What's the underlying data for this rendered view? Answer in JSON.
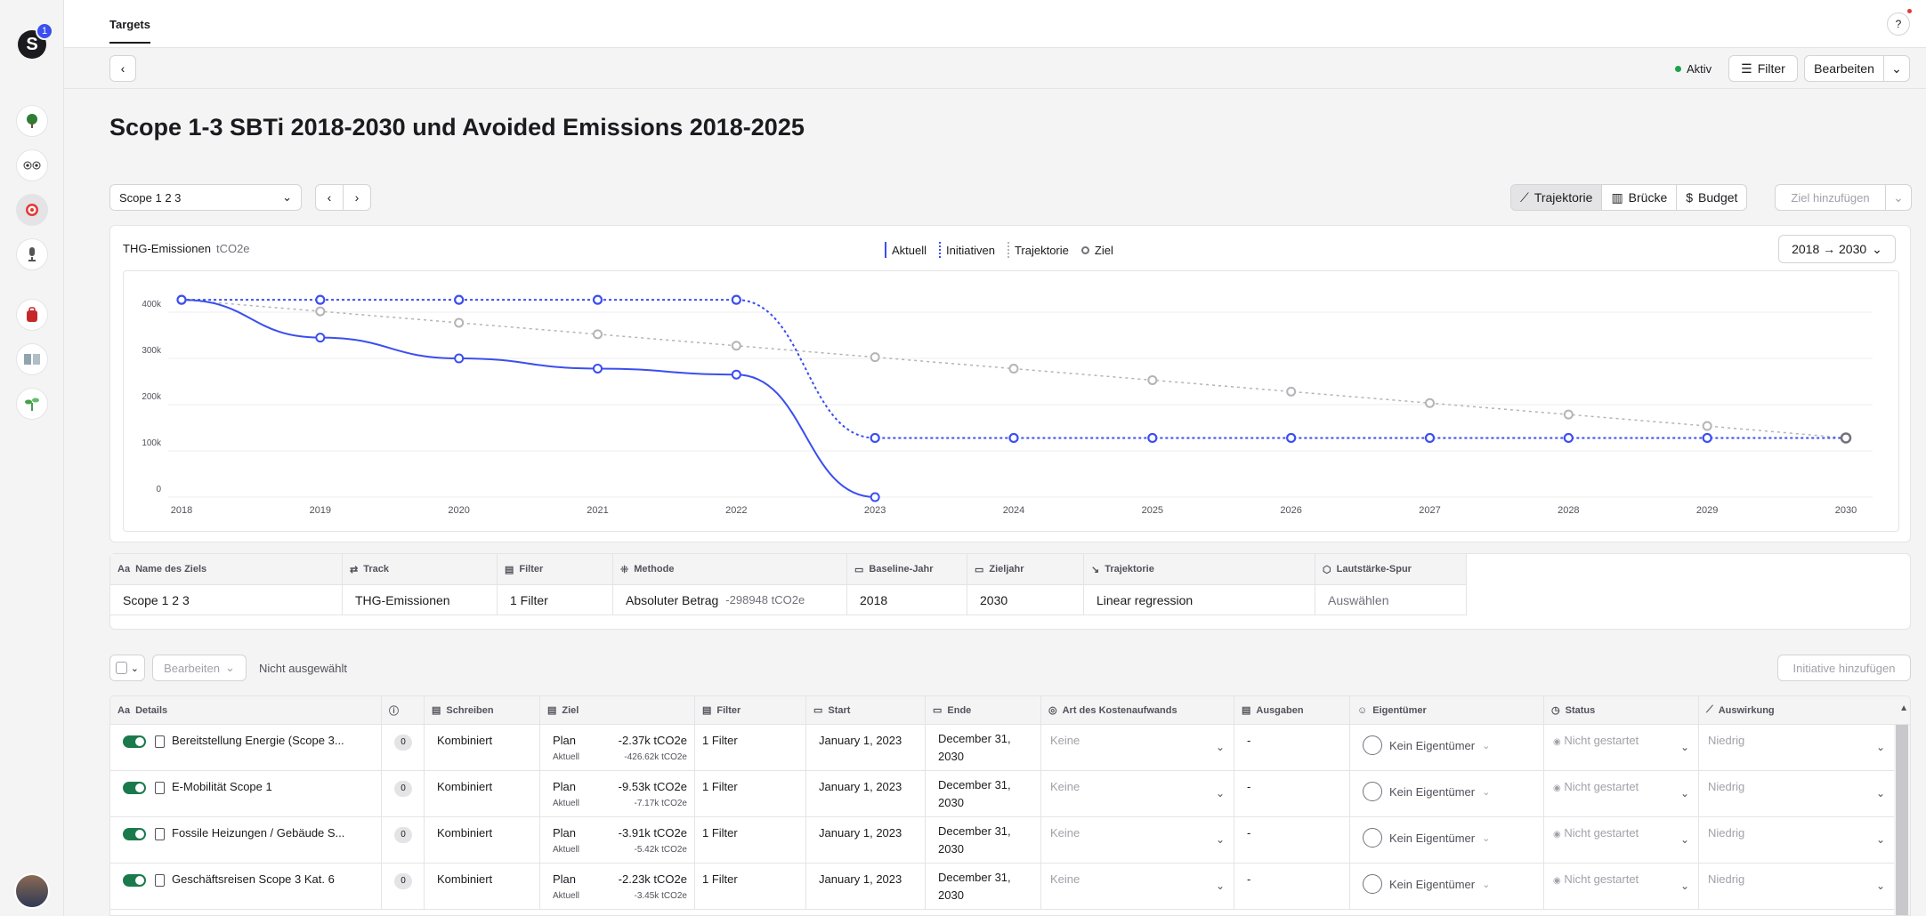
{
  "rail": {
    "notif_count": "1",
    "logo": "S",
    "items": [
      "tree-icon",
      "eyes-icon",
      "target-icon",
      "microphone-icon",
      "backpack-icon",
      "book-icon",
      "seedling-icon"
    ]
  },
  "topbar": {
    "tab": "Targets",
    "help": "?"
  },
  "toolbar": {
    "status": "Aktiv",
    "filter": "Filter",
    "edit": "Bearbeiten"
  },
  "page_title": "Scope 1-3 SBTi 2018-2030 und Avoided Emissions 2018-2025",
  "controls": {
    "scope_select": "Scope 1 2 3",
    "views": [
      "Trajektorie",
      "Brücke",
      "Budget"
    ],
    "add_goal": "Ziel hinzufügen"
  },
  "chart_card": {
    "title": "THG-Emissionen",
    "unit": "tCO2e",
    "legend": {
      "aktuell": "Aktuell",
      "initiativen": "Initiativen",
      "trajektorie": "Trajektorie",
      "ziel": "Ziel"
    },
    "range": "2018 → 2030"
  },
  "chart_data": {
    "type": "line",
    "x": [
      2018,
      2019,
      2020,
      2021,
      2022,
      2023,
      2024,
      2025,
      2026,
      2027,
      2028,
      2029,
      2030
    ],
    "yticks": [
      "0",
      "100k",
      "200k",
      "300k",
      "400k"
    ],
    "ylim": [
      0,
      450000
    ],
    "colors": {
      "aktuell": "#3b4ef0",
      "initiativen": "#3b4ef0",
      "trajektorie": "#b4b4b8",
      "ziel": "#71717a"
    },
    "series": [
      {
        "name": "Aktuell",
        "x": [
          2018,
          2019,
          2020,
          2021,
          2022,
          2023
        ],
        "values": [
          426620,
          345000,
          300000,
          278000,
          265000,
          0
        ]
      },
      {
        "name": "Initiativen",
        "x": [
          2018,
          2019,
          2020,
          2021,
          2022,
          2023,
          2024,
          2025,
          2026,
          2027,
          2028,
          2029,
          2030
        ],
        "values": [
          426620,
          426620,
          426620,
          426620,
          426620,
          128000,
          128000,
          128000,
          128000,
          128000,
          128000,
          128000,
          128000
        ]
      },
      {
        "name": "Trajektorie",
        "x": [
          2018,
          2019,
          2020,
          2021,
          2022,
          2023,
          2024,
          2025,
          2026,
          2027,
          2028,
          2029,
          2030
        ],
        "values": [
          426620,
          401800,
          377000,
          352200,
          327400,
          302600,
          277800,
          253000,
          228200,
          203400,
          178600,
          153800,
          128000
        ]
      },
      {
        "name": "Ziel",
        "x": [
          2030
        ],
        "values": [
          128000
        ]
      }
    ]
  },
  "params": {
    "headers": [
      "Name des Ziels",
      "Track",
      "Filter",
      "Methode",
      "Baseline-Jahr",
      "Zieljahr",
      "Trajektorie",
      "Lautstärke-Spur"
    ],
    "values": {
      "name": "Scope 1 2 3",
      "track": "THG-Emissionen",
      "filter": "1 Filter",
      "method": "Absoluter Betrag",
      "method_sub": "-298948 tCO2e",
      "baseline": "2018",
      "target_year": "2030",
      "trajectory": "Linear regression",
      "spur": "Auswählen"
    }
  },
  "initiatives_bar": {
    "bulk_edit": "Bearbeiten",
    "selection": "Nicht ausgewählt",
    "add": "Initiative hinzufügen"
  },
  "initiatives": {
    "headers": [
      "Details",
      "",
      "Schreiben",
      "Ziel",
      "Filter",
      "Start",
      "Ende",
      "Art des Kostenaufwands",
      "Ausgaben",
      "Eigentümer",
      "Status",
      "Auswirkung"
    ],
    "rows": [
      {
        "name": "Bereitstellung Energie (Scope 3...",
        "count": "0",
        "write": "Kombiniert",
        "plan": "Plan",
        "plan_val": "-2.37k tCO2e",
        "actual": "Aktuell",
        "actual_val": "-426.62k tCO2e",
        "filter": "1 Filter",
        "start": "January 1, 2023",
        "end1": "December 31,",
        "end2": "2030",
        "cost": "Keine",
        "spend": "-",
        "owner": "Kein Eigentümer",
        "status": "Nicht gestartet",
        "impact": "Niedrig"
      },
      {
        "name": "E-Mobilität Scope 1",
        "count": "0",
        "write": "Kombiniert",
        "plan": "Plan",
        "plan_val": "-9.53k tCO2e",
        "actual": "Aktuell",
        "actual_val": "-7.17k tCO2e",
        "filter": "1 Filter",
        "start": "January 1, 2023",
        "end1": "December 31,",
        "end2": "2030",
        "cost": "Keine",
        "spend": "-",
        "owner": "Kein Eigentümer",
        "status": "Nicht gestartet",
        "impact": "Niedrig"
      },
      {
        "name": "Fossile Heizungen / Gebäude S...",
        "count": "0",
        "write": "Kombiniert",
        "plan": "Plan",
        "plan_val": "-3.91k tCO2e",
        "actual": "Aktuell",
        "actual_val": "-5.42k tCO2e",
        "filter": "1 Filter",
        "start": "January 1, 2023",
        "end1": "December 31,",
        "end2": "2030",
        "cost": "Keine",
        "spend": "-",
        "owner": "Kein Eigentümer",
        "status": "Nicht gestartet",
        "impact": "Niedrig"
      },
      {
        "name": "Geschäftsreisen Scope 3 Kat. 6",
        "count": "0",
        "write": "Kombiniert",
        "plan": "Plan",
        "plan_val": "-2.23k tCO2e",
        "actual": "Aktuell",
        "actual_val": "-3.45k tCO2e",
        "filter": "1 Filter",
        "start": "January 1, 2023",
        "end1": "December 31,",
        "end2": "2030",
        "cost": "Keine",
        "spend": "-",
        "owner": "Kein Eigentümer",
        "status": "Nicht gestartet",
        "impact": "Niedrig"
      }
    ]
  }
}
